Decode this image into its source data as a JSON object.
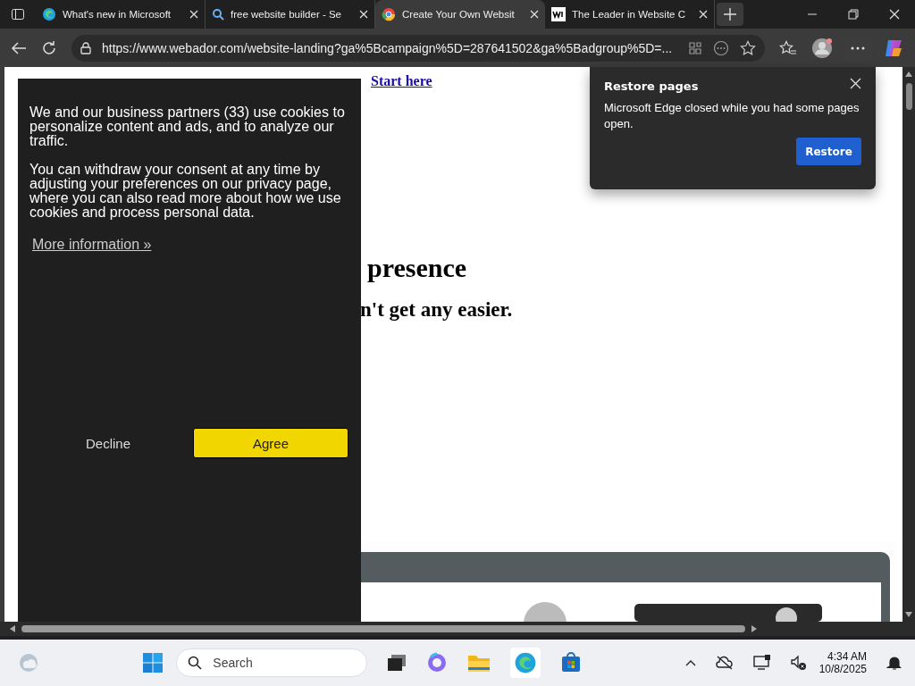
{
  "tabs": [
    {
      "kind": "edge",
      "title": "What's new in Microsoft",
      "selected": false
    },
    {
      "kind": "search",
      "title": "free website builder - Se",
      "selected": false
    },
    {
      "kind": "colorwheel",
      "title": "Create Your Own Websit",
      "selected": true
    },
    {
      "kind": "wix",
      "title": "The Leader in Website C",
      "selected": false
    }
  ],
  "address_bar": {
    "url": "https://www.webador.com/website-landing?ga%5Bcampaign%5D=287641502&ga%5Badgroup%5D=..."
  },
  "page": {
    "promo_link": "Start here",
    "headline_fragment": "presence",
    "subheadline_fragment": "n't get any easier."
  },
  "cookie_banner": {
    "paragraphs": [
      "We and our business partners (33) use cookies to personalize content and ads, and to analyze our traffic.",
      "You can withdraw your consent at any time by adjusting your preferences on our privacy page, where you can also read more about how we use cookies and process personal data."
    ],
    "link": "More information »",
    "decline": "Decline",
    "agree": "Agree"
  },
  "restore_popup": {
    "title": "Restore pages",
    "message": "Microsoft Edge closed while you had some pages open.",
    "button": "Restore"
  },
  "taskbar": {
    "search_placeholder": "Search",
    "time": "4:34 AM",
    "date": "10/8/2025"
  }
}
